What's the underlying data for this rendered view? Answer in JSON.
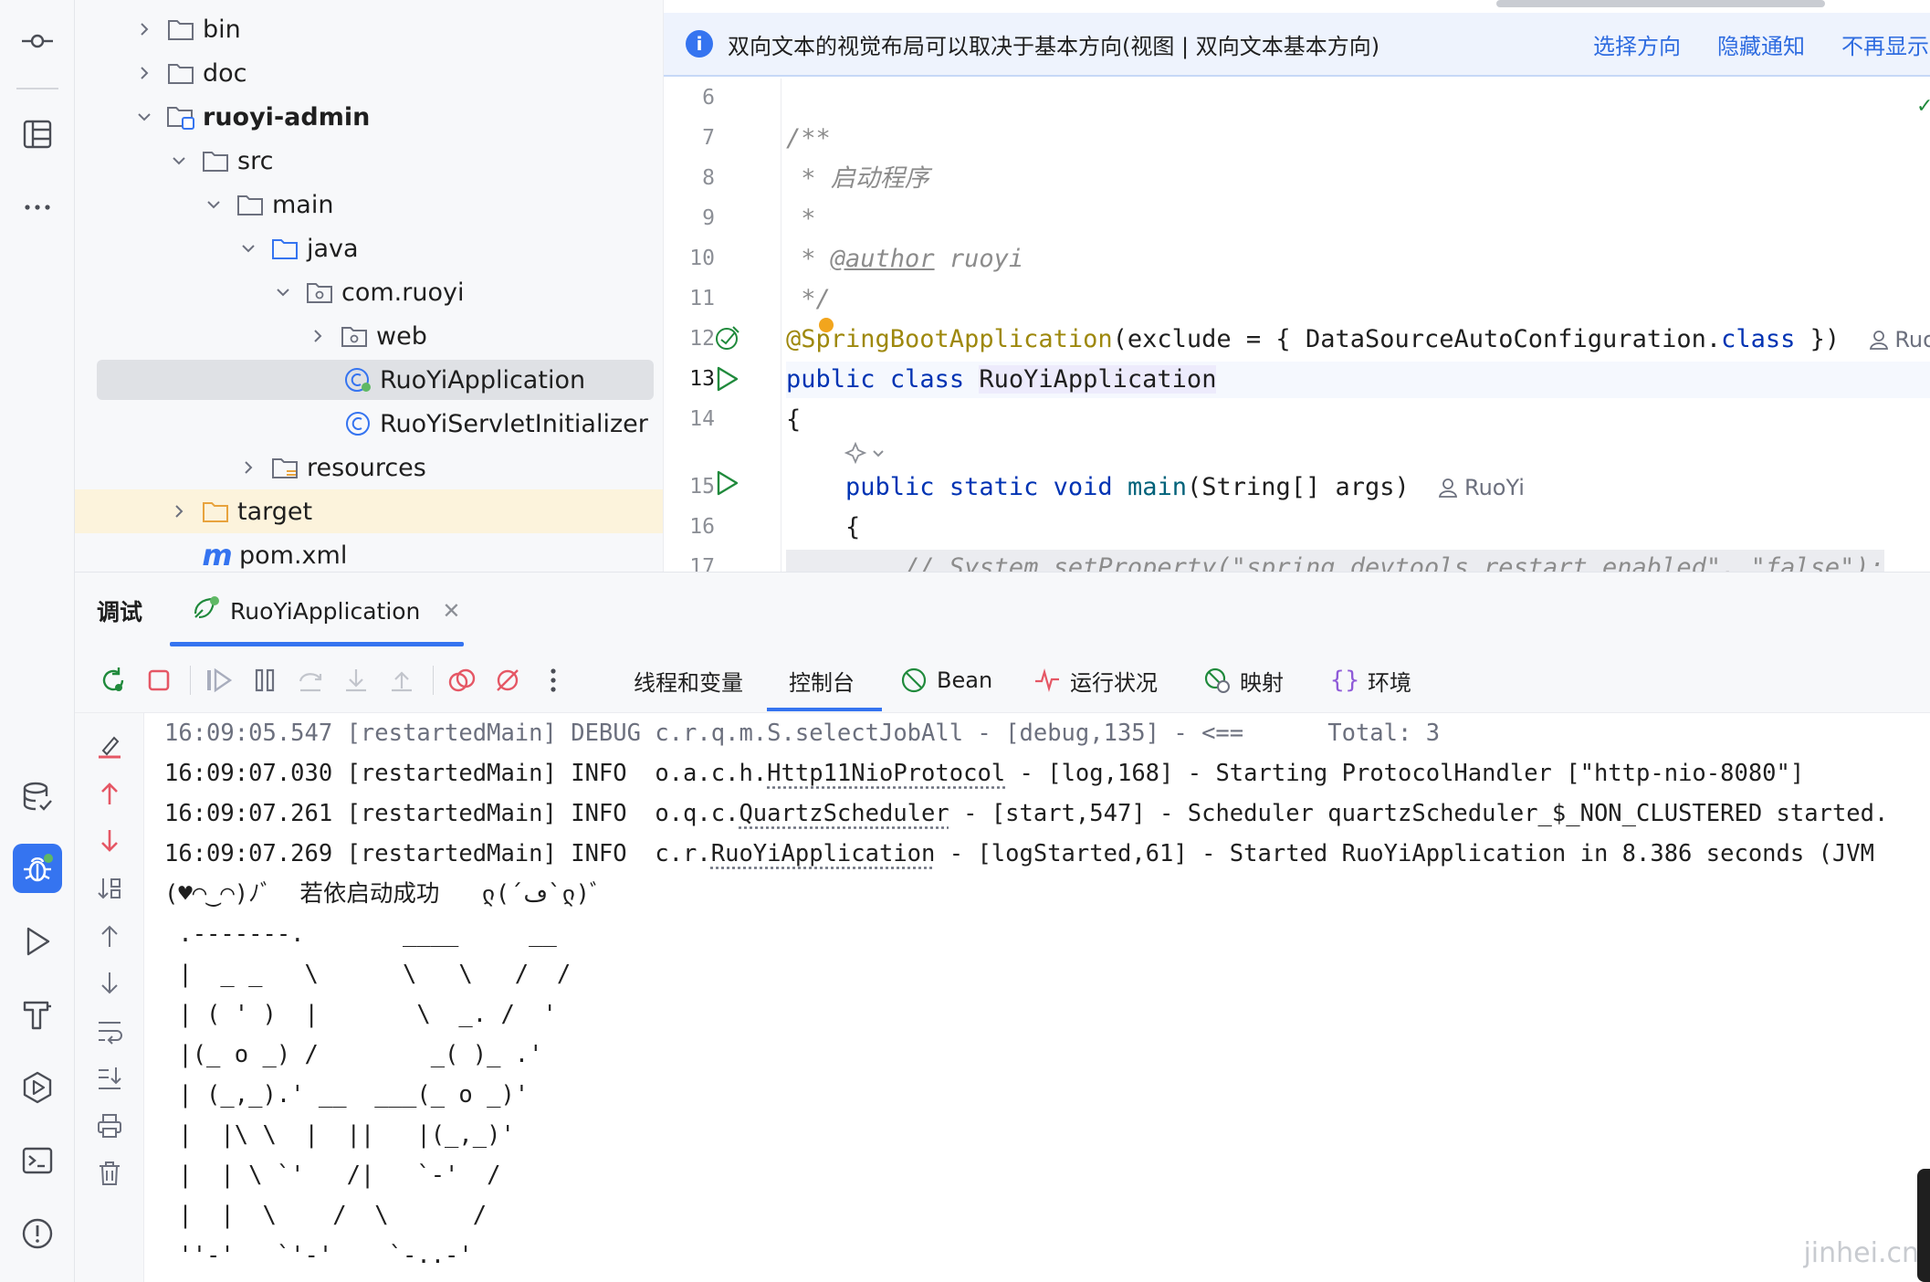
{
  "tree": {
    "items": [
      {
        "label": "bin"
      },
      {
        "label": "doc"
      },
      {
        "label": "ruoyi-admin"
      },
      {
        "label": "src"
      },
      {
        "label": "main"
      },
      {
        "label": "java"
      },
      {
        "label": "com.ruoyi"
      },
      {
        "label": "web"
      },
      {
        "label": "RuoYiApplication"
      },
      {
        "label": "RuoYiServletInitializer"
      },
      {
        "label": "resources"
      },
      {
        "label": "target"
      },
      {
        "label": "pom.xml"
      }
    ]
  },
  "notice": {
    "text": "双向文本的视觉布局可以取决于基本方向(视图 | 双向文本基本方向)",
    "link_choose": "选择方向",
    "link_hide": "隐藏通知",
    "link_never": "不再显示"
  },
  "editor": {
    "lines": [
      {
        "num": "6"
      },
      {
        "num": "7",
        "text": "/**"
      },
      {
        "num": "8",
        "text": " * 启动程序"
      },
      {
        "num": "9",
        "text": " *"
      },
      {
        "num": "10",
        "tag": "@author",
        "text": " ruoyi"
      },
      {
        "num": "11",
        "text": " */"
      },
      {
        "num": "12",
        "anno": "@SpringBootApplication",
        "text1": "(exclude = { DataSourceAutoConfiguration.",
        "kw": "class",
        "text2": " })",
        "author": "RuoYi"
      },
      {
        "num": "13",
        "kw1": "public",
        "kw2": "class",
        "cls": "RuoYiApplication"
      },
      {
        "num": "14",
        "text": "{"
      },
      {
        "num": "15",
        "kw1": "public",
        "kw2": "static",
        "kw3": "void",
        "method": "main",
        "params": "(String[] args)",
        "author": "RuoYi"
      },
      {
        "num": "16",
        "text": "    {"
      },
      {
        "num": "17",
        "text": "        // System.setProperty(\"spring.devtools.restart.enabled\", \"false\");"
      }
    ]
  },
  "debug": {
    "title": "调试",
    "session_tab": "RuoYiApplication",
    "panel_tabs": [
      "线程和变量",
      "控制台",
      "Bean",
      "运行状况",
      "映射",
      "环境"
    ],
    "active_panel_tab": "控制台"
  },
  "console": {
    "lines": [
      {
        "pre": "16:09:05.547 [restartedMain] DEBUG c.r.q.m.S.selectJobAll - [debug,135] - <==      Total: 3"
      },
      {
        "pre": "16:09:07.030 [restartedMain] INFO  o.a.c.h.",
        "link": "Http11NioProtocol",
        "post": " - [log,168] - Starting ProtocolHandler [\"http-nio-8080\"]"
      },
      {
        "pre": "16:09:07.261 [restartedMain] INFO  o.q.c.",
        "link": "QuartzScheduler",
        "post": " - [start,547] - Scheduler quartzScheduler_$_NON_CLUSTERED started."
      },
      {
        "pre": "16:09:07.269 [restartedMain] INFO  c.r.",
        "link": "RuoYiApplication",
        "post": " - [logStarted,61] - Started RuoYiApplication in 8.386 seconds (JVM"
      },
      {
        "pre": "(♥◠‿◠)ﾉﾞ  若依启动成功   ლ(´ڡ`ლ)ﾞ"
      },
      {
        "pre": " .-------.       ____     __"
      },
      {
        "pre": " |  _ _   \\      \\   \\   /  /"
      },
      {
        "pre": " | ( ' )  |       \\  _. /  '"
      },
      {
        "pre": " |(_ o _) /        _( )_ .'"
      },
      {
        "pre": " | (_,_).' __  ___(_ o _)'"
      },
      {
        "pre": " |  |\\ \\  |  ||   |(_,_)'"
      },
      {
        "pre": " |  | \\ `'   /|   `-'  /"
      },
      {
        "pre": " |  |  \\    /  \\      /"
      },
      {
        "pre": " ''-'   `'-'    `-..-'"
      }
    ]
  },
  "watermark": "jinhei.cn",
  "colors": {
    "accent": "#3574f0",
    "folder": "#6c707e",
    "target_folder": "#e8a33d",
    "run_green": "#208a3c",
    "stop_red": "#e55765"
  }
}
